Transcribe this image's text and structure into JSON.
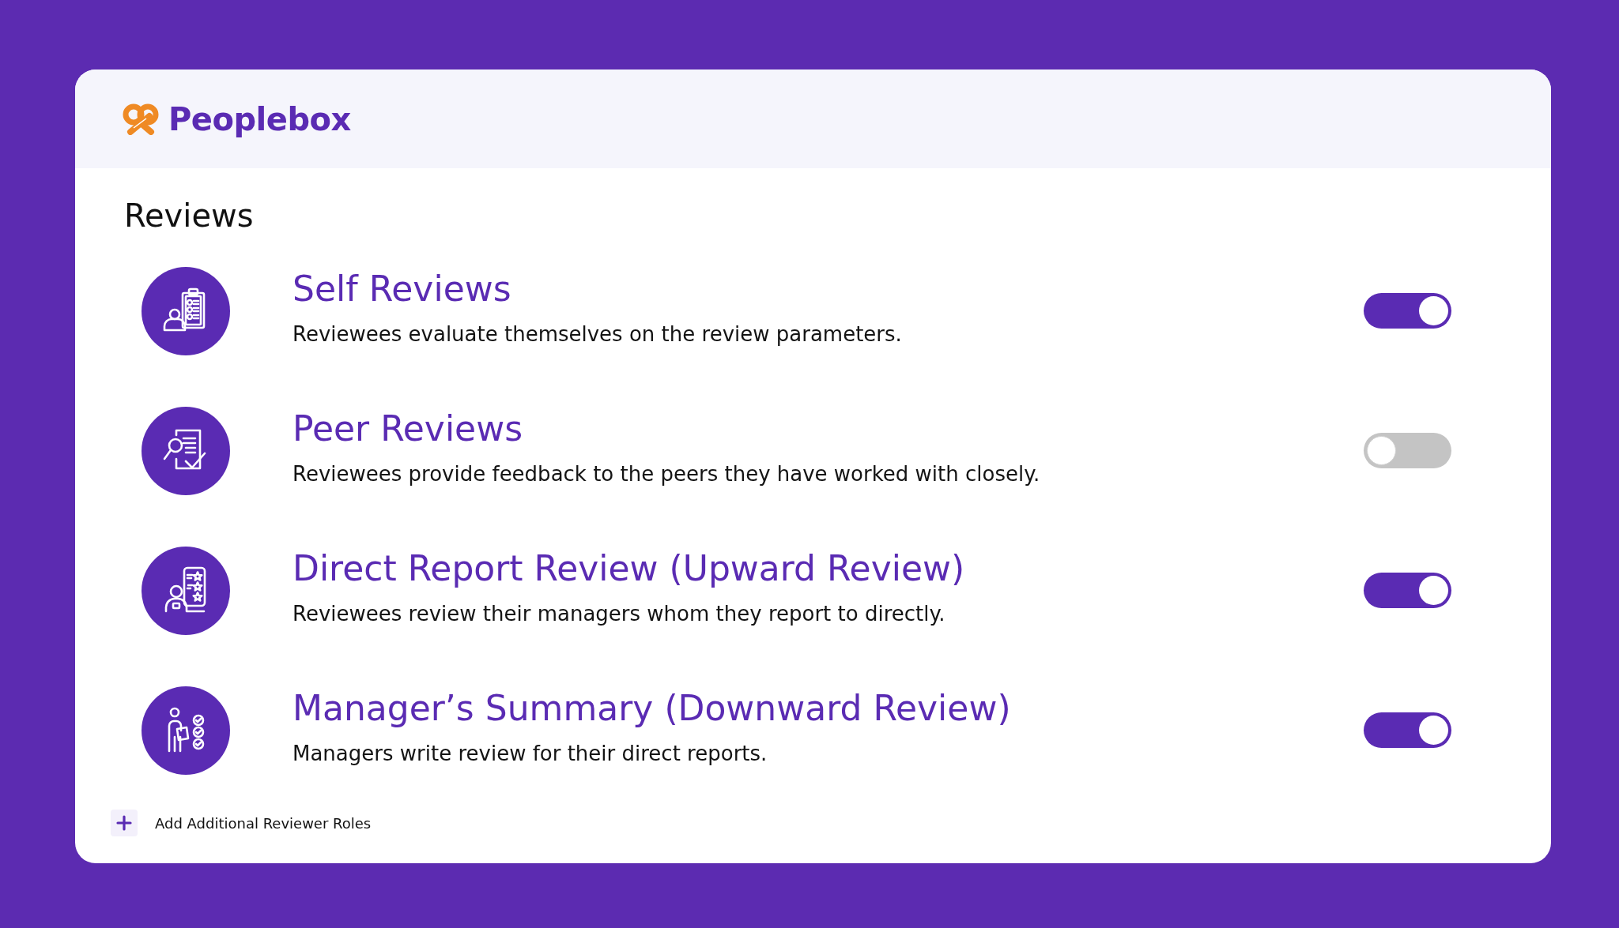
{
  "header": {
    "brand": "Peoplebox"
  },
  "section": {
    "title": "Reviews"
  },
  "review_types": [
    {
      "kind": "clipboard",
      "title": "Self Reviews",
      "description": "Reviewees evaluate themselves on the review parameters.",
      "on": true
    },
    {
      "kind": "magnifier",
      "title": "Peer Reviews",
      "description": "Reviewees provide feedback to the peers they have worked with closely.",
      "on": false
    },
    {
      "kind": "stars",
      "title": "Direct Report Review (Upward Review)",
      "description": "Reviewees review their managers whom they report to directly.",
      "on": true
    },
    {
      "kind": "checks",
      "title": "Manager’s Summary (Downward Review)",
      "description": "Managers write review for their direct reports.",
      "on": true
    }
  ],
  "add_button": {
    "label": "Add Additional Reviewer Roles"
  }
}
